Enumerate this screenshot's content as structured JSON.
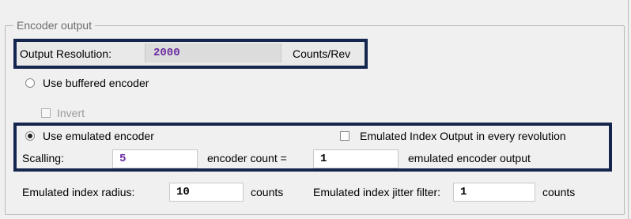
{
  "group": {
    "title": "Encoder output"
  },
  "resolution": {
    "label": "Output Resolution:",
    "value": "2000",
    "unit": "Counts/Rev"
  },
  "buffered": {
    "label": "Use buffered encoder",
    "checked": false,
    "invert_label": "Invert",
    "invert_checked": false,
    "invert_enabled": false
  },
  "emulated": {
    "label": "Use emulated encoder",
    "checked": true,
    "index_every_rev_label": "Emulated Index Output in every revolution",
    "index_every_rev_checked": false,
    "scaling_label": "Scalling:",
    "scaling_value": "5",
    "encoder_count_label": "encoder count =",
    "encoder_count_value": "1",
    "output_label": "emulated encoder output"
  },
  "index": {
    "radius_label": "Emulated index radius:",
    "radius_value": "10",
    "radius_unit": "counts",
    "jitter_label": "Emulated index jitter filter:",
    "jitter_value": "1",
    "jitter_unit": "counts"
  },
  "colors": {
    "highlight_border": "#15264e",
    "value_text": "#6a2aa0"
  }
}
